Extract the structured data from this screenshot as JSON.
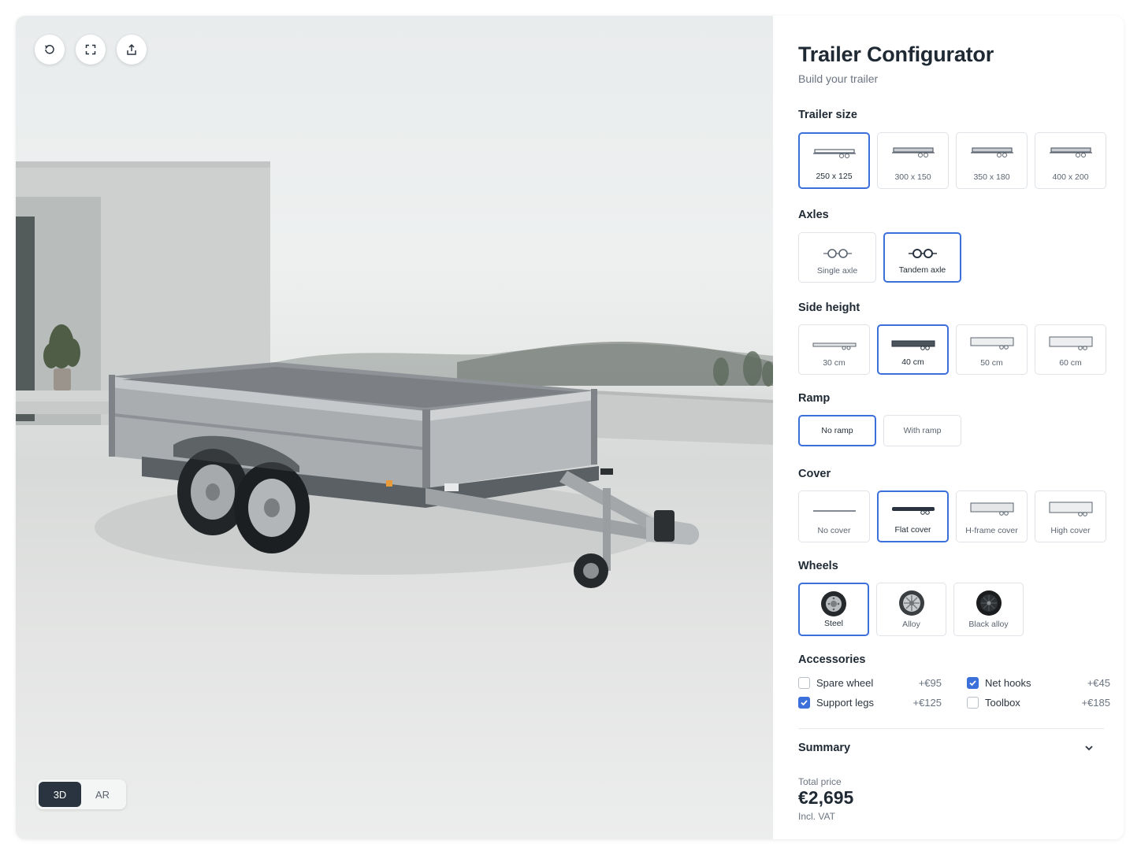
{
  "viewer": {
    "tools": [
      {
        "name": "reset-view-button",
        "icon": "rotate-ccw-icon"
      },
      {
        "name": "fullscreen-button",
        "icon": "expand-icon"
      },
      {
        "name": "share-button",
        "icon": "share-icon"
      }
    ],
    "modes": [
      {
        "label": "3D",
        "active": true
      },
      {
        "label": "AR",
        "active": false
      }
    ]
  },
  "panel": {
    "title": "Trailer Configurator",
    "subtitle": "Build your trailer",
    "sections": {
      "size": {
        "label": "Trailer size",
        "options": [
          "250 x 125",
          "300 x 150",
          "350 x 180",
          "400 x 200"
        ],
        "selected": 0
      },
      "axles": {
        "label": "Axles",
        "options": [
          "Single axle",
          "Tandem axle"
        ],
        "selected": 1
      },
      "side_height": {
        "label": "Side height",
        "options": [
          "30 cm",
          "40 cm",
          "50 cm",
          "60 cm"
        ],
        "selected": 1
      },
      "ramp": {
        "label": "Ramp",
        "options": [
          "No ramp",
          "With ramp"
        ],
        "selected": 0
      },
      "cover": {
        "label": "Cover",
        "options": [
          "No cover",
          "Flat cover",
          "H-frame cover",
          "High cover"
        ],
        "selected": 1
      },
      "wheels": {
        "label": "Wheels",
        "options": [
          "Steel",
          "Alloy",
          "Black alloy"
        ],
        "selected": 0
      }
    },
    "accessories": {
      "label": "Accessories",
      "items": [
        {
          "label": "Spare wheel",
          "price": "+€95",
          "checked": false
        },
        {
          "label": "Net hooks",
          "price": "+€45",
          "checked": true
        },
        {
          "label": "Support legs",
          "price": "+€125",
          "checked": true
        },
        {
          "label": "Toolbox",
          "price": "+€185",
          "checked": false
        }
      ]
    },
    "summary": {
      "label": "Summary",
      "icon": "chevron-down-icon"
    },
    "total": {
      "label": "Total price",
      "value": "€2,695",
      "vat": "Incl. VAT"
    }
  },
  "colors": {
    "accent": "#3b6fd9",
    "dark": "#2a3440",
    "text": "#1f2933",
    "muted": "#6b7480"
  }
}
